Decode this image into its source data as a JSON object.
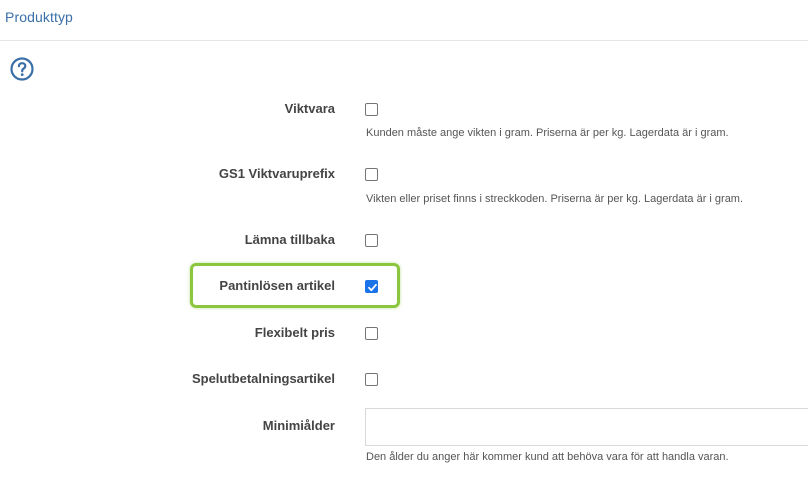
{
  "panel": {
    "title": "Produkttyp"
  },
  "colors": {
    "title": "#3a6fa8",
    "checkbox_checked": "#1a73e8",
    "highlight": "#8cc63f",
    "help_icon": "#3a6fa8"
  },
  "help_icon": "question-circle-icon",
  "fields": {
    "viktvara": {
      "label": "Viktvara",
      "checked": false,
      "help": "Kunden måste ange vikten i gram. Priserna är per kg. Lagerdata är i gram."
    },
    "gs1": {
      "label": "GS1 Viktvaruprefix",
      "checked": false,
      "help": "Vikten eller priset finns i streckkoden. Priserna är per kg. Lagerdata är i gram."
    },
    "lamna_tillbaka": {
      "label": "Lämna tillbaka",
      "checked": false
    },
    "pantinlosen": {
      "label": "Pantinlösen artikel",
      "checked": true
    },
    "flexibelt_pris": {
      "label": "Flexibelt pris",
      "checked": false
    },
    "spelutbetalning": {
      "label": "Spelutbetalningsartikel",
      "checked": false
    },
    "minimialder": {
      "label": "Minimiålder",
      "value": "",
      "help": "Den ålder du anger här kommer kund att behöva vara för att handla varan."
    }
  }
}
